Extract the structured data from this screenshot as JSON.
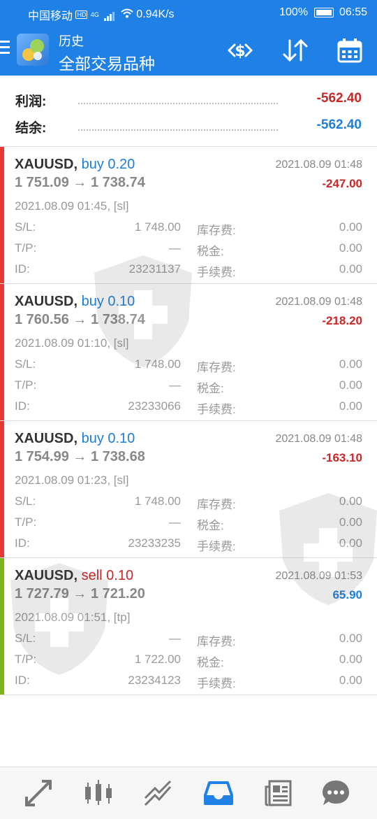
{
  "status_bar": {
    "carrier": "中国移动",
    "hd": "HD",
    "net": "4G",
    "speed": "0.94K/s",
    "battery_pct": "100%",
    "time": "06:55"
  },
  "header": {
    "subtitle": "历史",
    "title": "全部交易品种"
  },
  "summary": {
    "profit_label": "利润:",
    "profit_value": "-562.40",
    "balance_label": "结余:",
    "balance_value": "-562.40"
  },
  "labels": {
    "sl": "S/L:",
    "tp": "T/P:",
    "id": "ID:",
    "swap": "库存费:",
    "tax": "税金:",
    "commission": "手续费:"
  },
  "trades": [
    {
      "symbol": "XAUUSD,",
      "side": "buy 0.20",
      "close_time": "2021.08.09 01:48",
      "prices": "1 751.09 → 1 738.74",
      "profit": "-247.00",
      "open_info": "2021.08.09 01:45, [sl]",
      "sl": "1 748.00",
      "tp": "—",
      "id": "23231137",
      "swap": "0.00",
      "tax": "0.00",
      "commission": "0.00"
    },
    {
      "symbol": "XAUUSD,",
      "side": "buy 0.10",
      "close_time": "2021.08.09 01:48",
      "prices": "1 760.56 → 1 738.74",
      "profit": "-218.20",
      "open_info": "2021.08.09 01:10, [sl]",
      "sl": "1 748.00",
      "tp": "—",
      "id": "23233066",
      "swap": "0.00",
      "tax": "0.00",
      "commission": "0.00"
    },
    {
      "symbol": "XAUUSD,",
      "side": "buy 0.10",
      "close_time": "2021.08.09 01:48",
      "prices": "1 754.99 → 1 738.68",
      "profit": "-163.10",
      "open_info": "2021.08.09 01:23, [sl]",
      "sl": "1 748.00",
      "tp": "—",
      "id": "23233235",
      "swap": "0.00",
      "tax": "0.00",
      "commission": "0.00"
    },
    {
      "symbol": "XAUUSD,",
      "side": "sell 0.10",
      "close_time": "2021.08.09 01:53",
      "prices": "1 727.79 → 1 721.20",
      "profit": "65.90",
      "open_info": "2021.08.09 01:51, [tp]",
      "sl": "—",
      "tp": "1 722.00",
      "id": "23234123",
      "swap": "0.00",
      "tax": "0.00",
      "commission": "0.00"
    }
  ],
  "colors": {
    "header_blue": "#1f80e6",
    "loss_red": "#c62828",
    "profit_blue": "#1e7fd8",
    "buy_blue": "#1e7fd8",
    "sell_red": "#c62828",
    "buy_bar": "#e53935",
    "sell_bar": "#7cb518"
  },
  "icons": {
    "header": [
      "currency-exchange-icon",
      "sort-icon",
      "calendar-icon"
    ],
    "bottom_nav": [
      "quotes-icon",
      "chart-icon",
      "trade-icon",
      "history-icon",
      "news-icon",
      "chat-icon"
    ]
  }
}
